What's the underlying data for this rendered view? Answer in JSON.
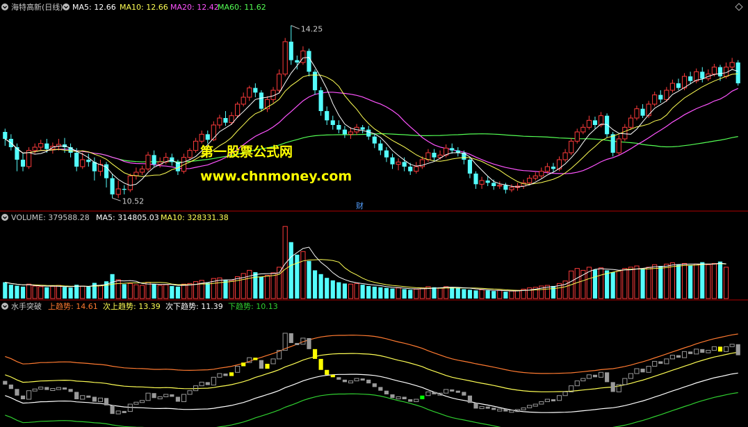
{
  "colors": {
    "background": "#000000",
    "up": "#ff3b3b",
    "down": "#54fcfc",
    "ma5": "#ffffff",
    "ma10": "#ffff54",
    "ma20": "#ff54ff",
    "ma60": "#54ff54",
    "gray_bar": "#9a9a9a",
    "highlight_up": "#ffff00",
    "highlight_down": "#00ff00",
    "upper_trend": "#ff7a30",
    "next_upper": "#ffff54",
    "next_lower": "#ffffff",
    "lower_trend": "#30d030",
    "watermark": "#ffff00",
    "divider": "#b00000"
  },
  "header": {
    "price": {
      "name": "海特高新(日线)",
      "ma5_label": "MA5: 12.66",
      "ma10_label": "MA10: 12.66",
      "ma20_label": "MA20: 12.42",
      "ma60_label": "MA60: 11.62"
    },
    "volume": {
      "name": "VOLUME: 379588.28",
      "ma5_label": "MA5: 314805.03",
      "ma10_label": "MA10: 328331.38"
    },
    "indicator": {
      "name": "水手突破",
      "upper_label": "上趋势: 14.61",
      "next_upper_label": "次上趋势: 13.39",
      "next_lower_label": "次下趋势: 11.39",
      "lower_label": "下趋势: 10.13"
    }
  },
  "annotations": {
    "high": "14.25",
    "low": "10.52",
    "finance_marker": "财"
  },
  "watermark": {
    "line1": "第一股票公式网",
    "line2": "www.chnmoney.com"
  },
  "icons": {
    "panel_toggle": "chevron-down-icon",
    "corner": "diamond-icon"
  },
  "chart_data": {
    "type": "candlestick",
    "title": "海特高新(日线)",
    "ylim": [
      10.3,
      14.5
    ],
    "annotated_high": 14.25,
    "annotated_low": 10.52,
    "candles": [
      [
        11.95,
        11.8,
        12.02,
        11.65
      ],
      [
        11.8,
        11.62,
        11.9,
        11.55
      ],
      [
        11.62,
        11.35,
        11.7,
        11.1
      ],
      [
        11.35,
        11.2,
        11.5,
        11.1
      ],
      [
        11.2,
        11.55,
        11.62,
        11.15
      ],
      [
        11.55,
        11.62,
        11.7,
        11.48
      ],
      [
        11.62,
        11.7,
        11.78,
        11.55
      ],
      [
        11.7,
        11.58,
        11.8,
        11.5
      ],
      [
        11.58,
        11.64,
        11.72,
        11.48
      ],
      [
        11.64,
        11.68,
        11.8,
        11.55
      ],
      [
        11.68,
        11.62,
        11.82,
        11.5
      ],
      [
        11.62,
        11.5,
        11.7,
        11.4
      ],
      [
        11.5,
        11.2,
        11.6,
        11.1
      ],
      [
        11.2,
        11.35,
        11.5,
        11.15
      ],
      [
        11.35,
        11.3,
        11.48,
        11.2
      ],
      [
        11.3,
        11.1,
        11.4,
        10.9
      ],
      [
        11.1,
        11.25,
        11.35,
        11.0
      ],
      [
        11.25,
        10.95,
        11.3,
        10.75
      ],
      [
        10.95,
        10.6,
        11.05,
        10.52
      ],
      [
        10.6,
        10.72,
        10.9,
        10.52
      ],
      [
        10.72,
        10.7,
        10.8,
        10.6
      ],
      [
        10.7,
        11.0,
        11.05,
        10.65
      ],
      [
        11.0,
        11.08,
        11.18,
        10.92
      ],
      [
        11.08,
        11.15,
        11.22,
        11.02
      ],
      [
        11.15,
        11.45,
        11.52,
        11.1
      ],
      [
        11.45,
        11.25,
        11.55,
        11.2
      ],
      [
        11.25,
        11.3,
        11.4,
        11.18
      ],
      [
        11.3,
        11.4,
        11.5,
        11.25
      ],
      [
        11.4,
        11.3,
        11.48,
        11.22
      ],
      [
        11.3,
        11.1,
        11.35,
        11.02
      ],
      [
        11.1,
        11.4,
        11.48,
        11.05
      ],
      [
        11.4,
        11.55,
        11.6,
        11.35
      ],
      [
        11.55,
        11.75,
        11.82,
        11.5
      ],
      [
        11.75,
        11.9,
        11.98,
        11.7
      ],
      [
        11.9,
        11.78,
        11.98,
        11.7
      ],
      [
        11.78,
        12.1,
        12.18,
        11.75
      ],
      [
        12.1,
        12.25,
        12.32,
        12.02
      ],
      [
        12.25,
        12.15,
        12.4,
        12.08
      ],
      [
        12.15,
        12.3,
        12.38,
        12.1
      ],
      [
        12.3,
        12.55,
        12.6,
        12.25
      ],
      [
        12.55,
        12.7,
        12.8,
        12.5
      ],
      [
        12.7,
        12.9,
        12.95,
        12.62
      ],
      [
        12.9,
        12.8,
        13.0,
        12.7
      ],
      [
        12.8,
        12.45,
        12.85,
        12.4
      ],
      [
        12.45,
        12.65,
        12.72,
        12.38
      ],
      [
        12.65,
        12.85,
        12.92,
        12.58
      ],
      [
        12.85,
        13.2,
        13.3,
        12.8
      ],
      [
        13.2,
        13.9,
        13.98,
        13.15
      ],
      [
        13.9,
        13.5,
        14.25,
        13.4
      ],
      [
        13.5,
        13.45,
        13.6,
        13.3
      ],
      [
        13.45,
        13.7,
        13.8,
        13.4
      ],
      [
        13.7,
        13.25,
        13.75,
        13.15
      ],
      [
        13.25,
        12.85,
        13.3,
        12.75
      ],
      [
        12.85,
        12.4,
        12.92,
        12.3
      ],
      [
        12.4,
        12.2,
        12.5,
        12.1
      ],
      [
        12.2,
        12.1,
        12.3,
        12.0
      ],
      [
        12.1,
        12.0,
        12.2,
        11.92
      ],
      [
        12.0,
        11.9,
        12.08,
        11.82
      ],
      [
        11.9,
        11.95,
        12.05,
        11.8
      ],
      [
        11.95,
        12.05,
        12.12,
        11.88
      ],
      [
        12.05,
        12.0,
        12.1,
        11.92
      ],
      [
        12.0,
        11.85,
        12.08,
        11.78
      ],
      [
        11.85,
        11.7,
        11.92,
        11.6
      ],
      [
        11.7,
        11.55,
        11.78,
        11.45
      ],
      [
        11.55,
        11.4,
        11.62,
        11.3
      ],
      [
        11.4,
        11.25,
        11.48,
        11.15
      ],
      [
        11.25,
        11.3,
        11.38,
        11.12
      ],
      [
        11.3,
        11.2,
        11.4,
        11.1
      ],
      [
        11.2,
        11.1,
        11.28,
        11.02
      ],
      [
        11.1,
        11.2,
        11.3,
        11.05
      ],
      [
        11.2,
        11.35,
        11.42,
        11.15
      ],
      [
        11.35,
        11.5,
        11.58,
        11.3
      ],
      [
        11.5,
        11.4,
        11.58,
        11.32
      ],
      [
        11.4,
        11.45,
        11.55,
        11.35
      ],
      [
        11.45,
        11.6,
        11.68,
        11.4
      ],
      [
        11.6,
        11.55,
        11.7,
        11.48
      ],
      [
        11.55,
        11.5,
        11.62,
        11.42
      ],
      [
        11.5,
        11.35,
        11.55,
        11.25
      ],
      [
        11.35,
        11.05,
        11.4,
        10.95
      ],
      [
        11.05,
        10.82,
        11.1,
        10.72
      ],
      [
        10.82,
        10.9,
        10.98,
        10.72
      ],
      [
        10.9,
        10.85,
        11.0,
        10.78
      ],
      [
        10.85,
        10.78,
        10.92,
        10.7
      ],
      [
        10.78,
        10.8,
        10.88,
        10.72
      ],
      [
        10.8,
        10.7,
        10.85,
        10.62
      ],
      [
        10.7,
        10.75,
        10.82,
        10.65
      ],
      [
        10.75,
        10.78,
        10.85,
        10.68
      ],
      [
        10.78,
        10.85,
        10.92,
        10.72
      ],
      [
        10.85,
        10.95,
        11.02,
        10.8
      ],
      [
        10.95,
        11.0,
        11.08,
        10.9
      ],
      [
        11.0,
        11.1,
        11.18,
        10.95
      ],
      [
        11.1,
        11.2,
        11.28,
        11.05
      ],
      [
        11.2,
        11.15,
        11.28,
        11.08
      ],
      [
        11.15,
        11.35,
        11.42,
        11.1
      ],
      [
        11.35,
        11.5,
        11.58,
        11.3
      ],
      [
        11.5,
        11.75,
        11.82,
        11.45
      ],
      [
        11.75,
        11.95,
        12.02,
        11.7
      ],
      [
        11.95,
        12.05,
        12.12,
        11.9
      ],
      [
        12.05,
        12.2,
        12.3,
        12.0
      ],
      [
        12.2,
        12.1,
        12.28,
        12.02
      ],
      [
        12.1,
        12.3,
        12.38,
        12.05
      ],
      [
        12.3,
        11.9,
        12.35,
        11.82
      ],
      [
        11.9,
        11.5,
        11.95,
        11.42
      ],
      [
        11.5,
        11.8,
        11.88,
        11.45
      ],
      [
        11.8,
        12.05,
        12.12,
        11.75
      ],
      [
        12.05,
        12.25,
        12.32,
        12.0
      ],
      [
        12.25,
        12.45,
        12.52,
        12.2
      ],
      [
        12.45,
        12.3,
        12.55,
        12.25
      ],
      [
        12.3,
        12.55,
        12.62,
        12.25
      ],
      [
        12.55,
        12.75,
        12.82,
        12.5
      ],
      [
        12.75,
        12.65,
        12.85,
        12.58
      ],
      [
        12.65,
        12.85,
        12.92,
        12.6
      ],
      [
        12.85,
        13.0,
        13.08,
        12.8
      ],
      [
        13.0,
        12.9,
        13.1,
        12.85
      ],
      [
        12.9,
        13.15,
        13.22,
        12.85
      ],
      [
        13.15,
        13.05,
        13.25,
        12.98
      ],
      [
        13.05,
        13.25,
        13.32,
        13.0
      ],
      [
        13.25,
        13.1,
        13.35,
        13.02
      ],
      [
        13.1,
        13.2,
        13.3,
        13.05
      ],
      [
        13.2,
        13.35,
        13.42,
        13.15
      ],
      [
        13.35,
        13.15,
        13.4,
        13.05
      ],
      [
        13.15,
        13.35,
        13.45,
        13.1
      ],
      [
        13.35,
        13.45,
        13.55,
        13.3
      ],
      [
        13.45,
        13.0,
        13.5,
        12.95
      ]
    ],
    "volume": [
      52,
      44,
      41,
      38,
      46,
      40,
      38,
      36,
      39,
      42,
      37,
      35,
      44,
      40,
      38,
      50,
      42,
      55,
      78,
      60,
      46,
      48,
      44,
      42,
      52,
      46,
      42,
      44,
      40,
      38,
      46,
      48,
      54,
      58,
      50,
      64,
      66,
      60,
      58,
      70,
      80,
      90,
      84,
      70,
      74,
      82,
      100,
      230,
      180,
      140,
      150,
      120,
      90,
      78,
      66,
      58,
      52,
      48,
      46,
      48,
      44,
      40,
      38,
      36,
      34,
      32,
      34,
      30,
      28,
      30,
      34,
      38,
      36,
      34,
      38,
      36,
      34,
      30,
      28,
      26,
      28,
      26,
      24,
      26,
      22,
      24,
      26,
      30,
      34,
      36,
      40,
      42,
      40,
      48,
      56,
      88,
      96,
      90,
      100,
      92,
      98,
      90,
      84,
      88,
      96,
      100,
      104,
      94,
      100,
      108,
      104,
      110,
      114,
      108,
      112,
      106,
      110,
      116,
      108,
      112,
      118,
      100
    ],
    "indicator_highlights": {
      "up": [
        38,
        40,
        42,
        44,
        52,
        53,
        54,
        55,
        120
      ],
      "down": [
        70
      ]
    }
  }
}
